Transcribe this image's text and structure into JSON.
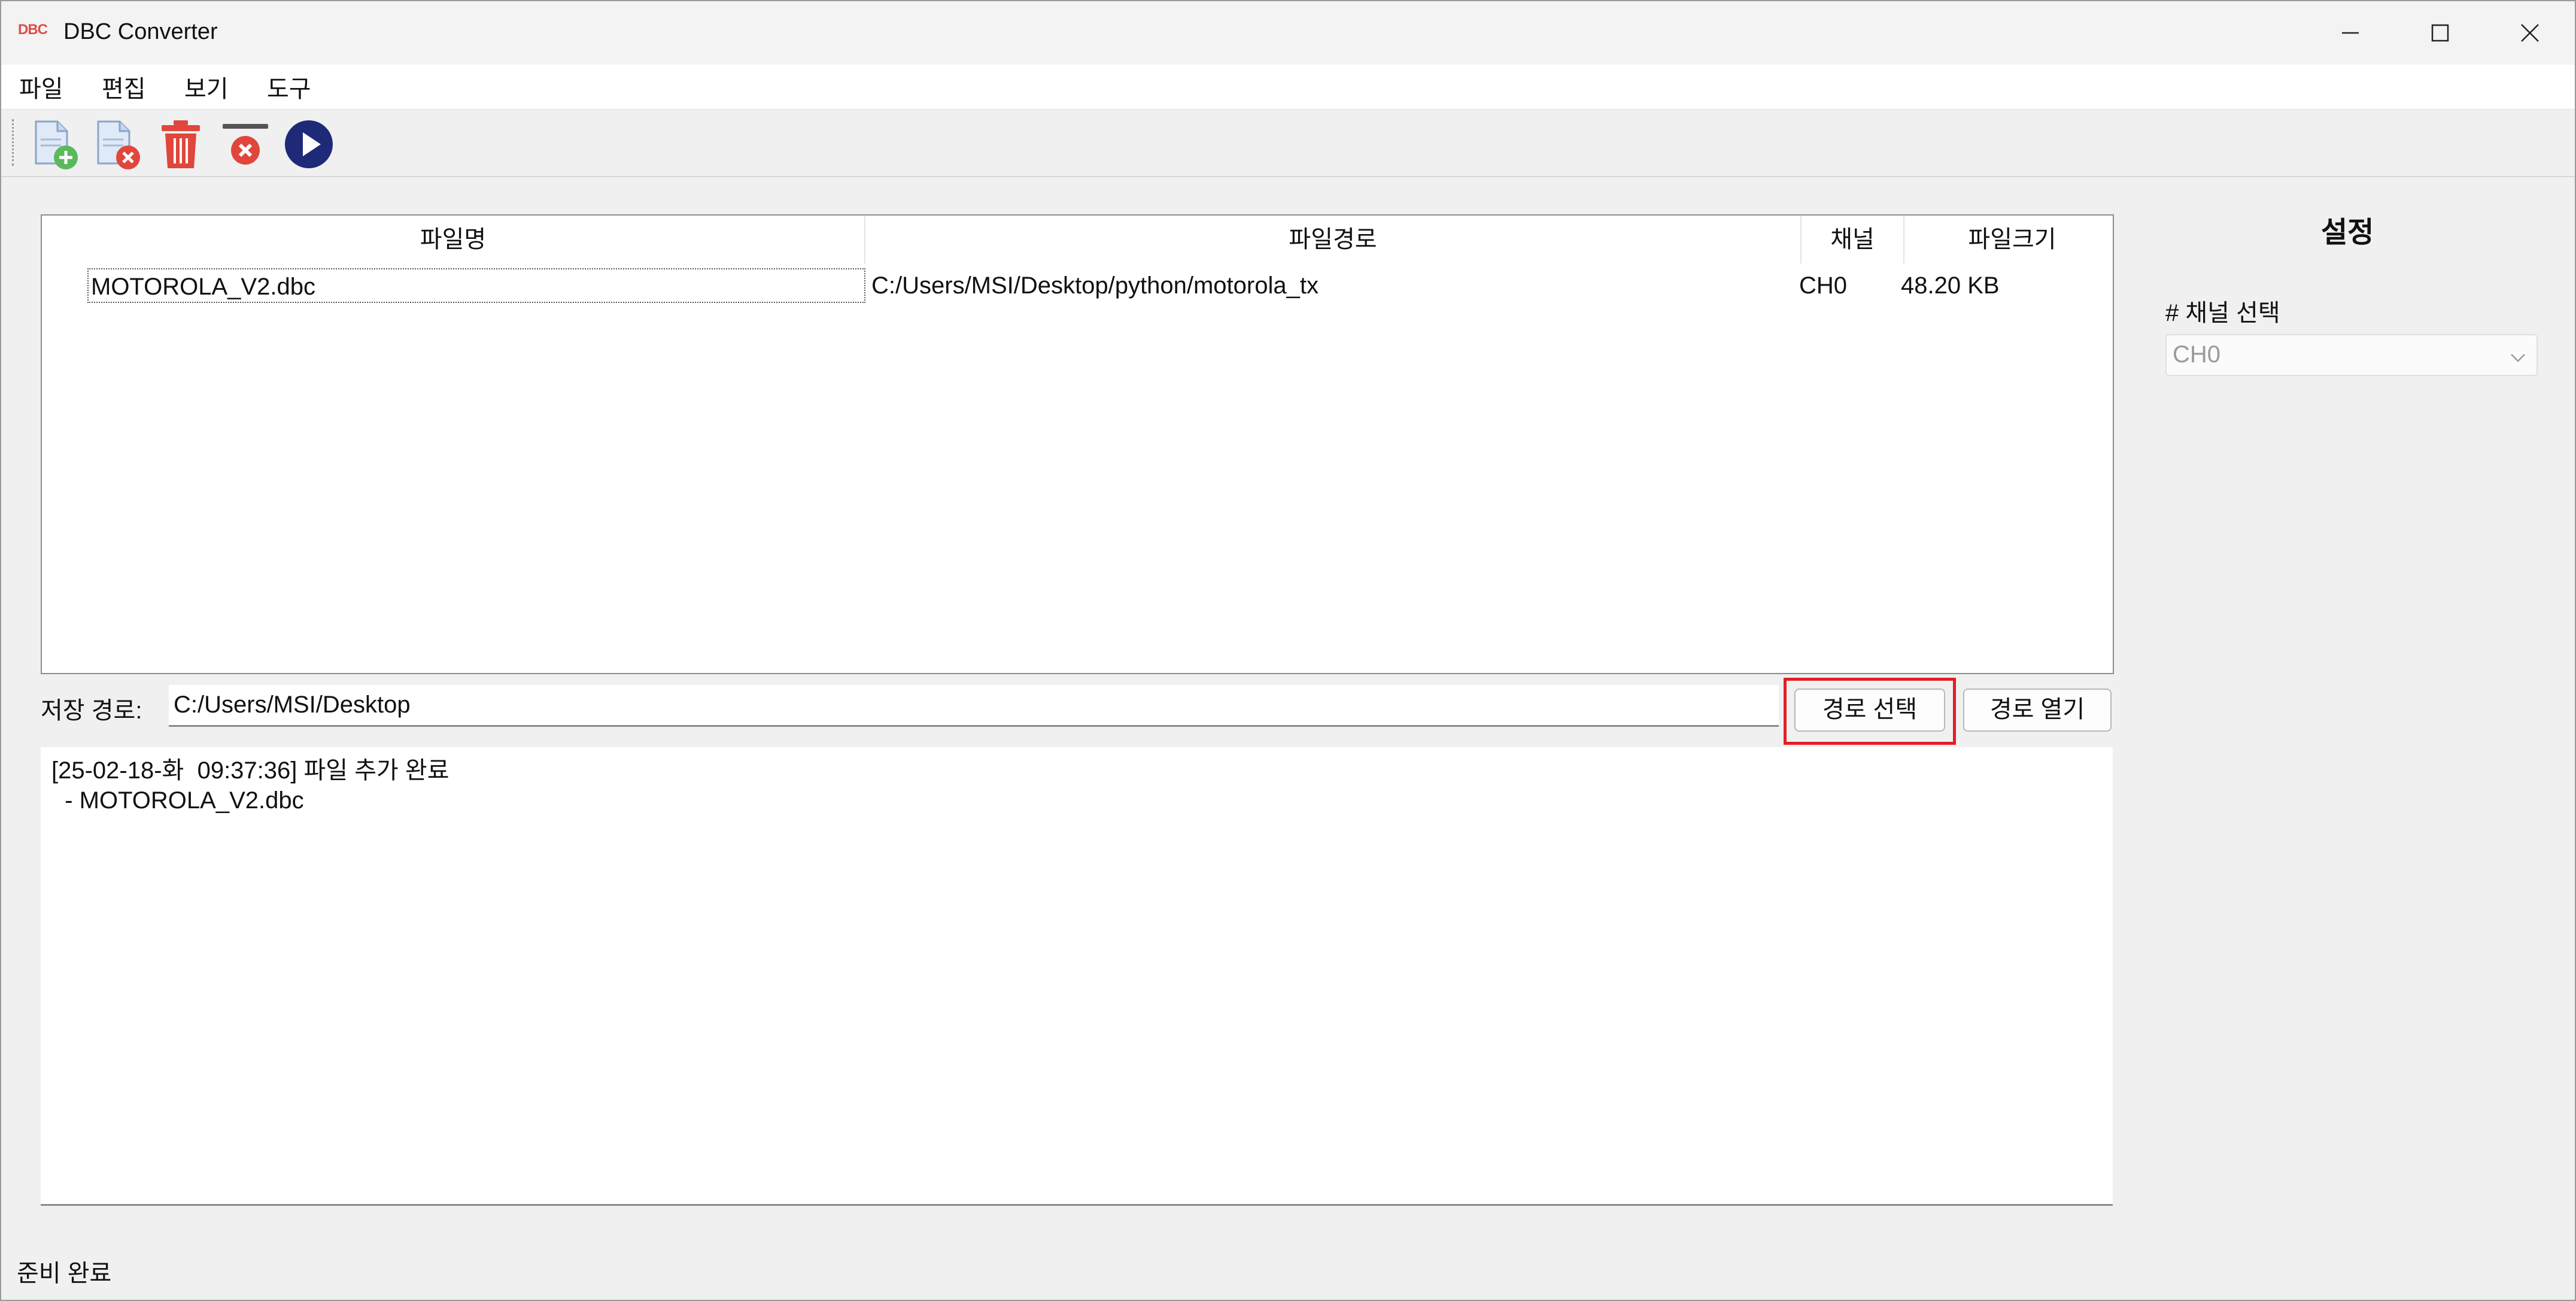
{
  "window": {
    "logo": "DBC",
    "title": "DBC Converter"
  },
  "menu": [
    "파일",
    "편집",
    "보기",
    "도구"
  ],
  "toolbar": {
    "buttons": [
      {
        "name": "add-file",
        "icon": "file-add-icon"
      },
      {
        "name": "remove-file",
        "icon": "file-remove-icon"
      },
      {
        "name": "delete",
        "icon": "trash-icon"
      },
      {
        "name": "clear",
        "icon": "clear-icon"
      },
      {
        "name": "run",
        "icon": "play-icon"
      }
    ]
  },
  "file_table": {
    "columns": [
      "파일명",
      "파일경로",
      "채널",
      "파일크기"
    ],
    "rows": [
      {
        "name": "MOTOROLA_V2.dbc",
        "path": "C:/Users/MSI/Desktop/python/motorola_tx",
        "channel": "CH0",
        "size": "48.20 KB"
      }
    ]
  },
  "save_path": {
    "label": "저장 경로:",
    "value": "C:/Users/MSI/Desktop",
    "select_button": "경로 선택",
    "open_button": "경로 열기"
  },
  "log": {
    "lines": [
      "[25-02-18-화  09:37:36] 파일 추가 완료",
      "  - MOTOROLA_V2.dbc"
    ]
  },
  "settings": {
    "title": "설정",
    "channel_label": "# 채널 선택",
    "channel_value": "CH0"
  },
  "status": "준비 완료",
  "colors": {
    "accent_highlight": "#e31e24",
    "play": "#1e2a78",
    "trash": "#e0463c"
  }
}
